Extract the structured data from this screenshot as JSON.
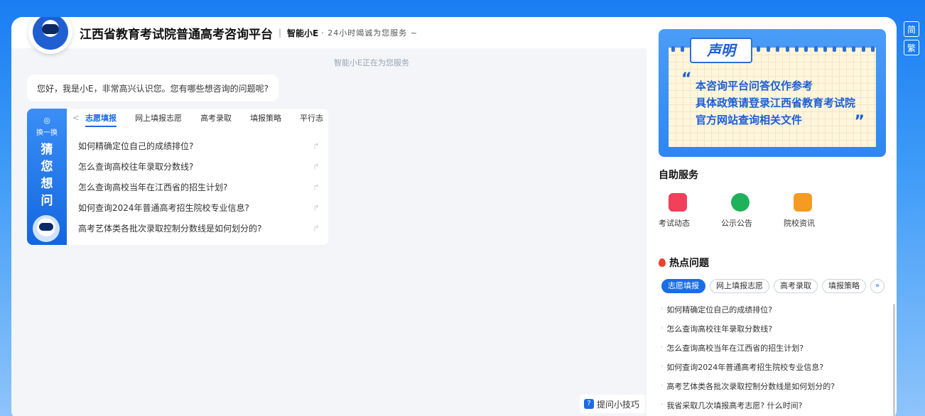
{
  "lang": {
    "simplified": "简",
    "traditional": "繁"
  },
  "header": {
    "title": "江西省教育考试院普通高考咨询平台",
    "separator": "|",
    "brand": "智能小E",
    "slogan": "· 24小时竭诚为您服务 ~"
  },
  "status": "智能小E正在为您服务",
  "greeting": "您好，我是小E，非常高兴认识您。您有哪些想咨询的问题呢?",
  "guess": {
    "swap_icon": "◎",
    "swap_label": "换一换",
    "chars": [
      "猜",
      "您",
      "想",
      "问"
    ],
    "tabs": [
      "志愿填报",
      "网上填报志愿",
      "高考录取",
      "填报策略",
      "平行志"
    ],
    "tab_prev": "<",
    "tab_next": ">",
    "questions": [
      "如何精确定位自己的成绩排位?",
      "怎么查询高校往年录取分数线?",
      "怎么查询高校当年在江西省的招生计划?",
      "如何查询2024年普通高考招生院校专业信息?",
      "高考艺体类各批次录取控制分数线是如何划分的?"
    ],
    "question_arrow": "↱"
  },
  "tips": {
    "icon": "?",
    "label": "提问小技巧"
  },
  "notice": {
    "tag": "声明",
    "quote_open": "“",
    "quote_close": "”",
    "lines": [
      "本咨询平台问答仅作参考",
      "具体政策请登录江西省教育考试院",
      "官方网站查询相关文件"
    ]
  },
  "self_service": {
    "title": "自助服务",
    "items": [
      {
        "label": "考试动态",
        "icon": "document-icon",
        "color": "#f0405a"
      },
      {
        "label": "公示公告",
        "icon": "users-icon",
        "color": "#1fb25a"
      },
      {
        "label": "院校资讯",
        "icon": "graduation-cap-icon",
        "color": "#f59a23"
      }
    ]
  },
  "hot": {
    "title": "热点问题",
    "tabs": [
      "志愿填报",
      "网上填报志愿",
      "高考录取",
      "填报策略"
    ],
    "more": "»",
    "questions": [
      "如何精确定位自己的成绩排位?",
      "怎么查询高校往年录取分数线?",
      "怎么查询高校当年在江西省的招生计划?",
      "如何查询2024年普通高考招生院校专业信息?",
      "高考艺体类各批次录取控制分数线是如何划分的?",
      "我省采取几次填报高考志愿? 什么时间?"
    ]
  },
  "colors": {
    "accent": "#1a6de6",
    "background_top": "#1a7df2"
  }
}
